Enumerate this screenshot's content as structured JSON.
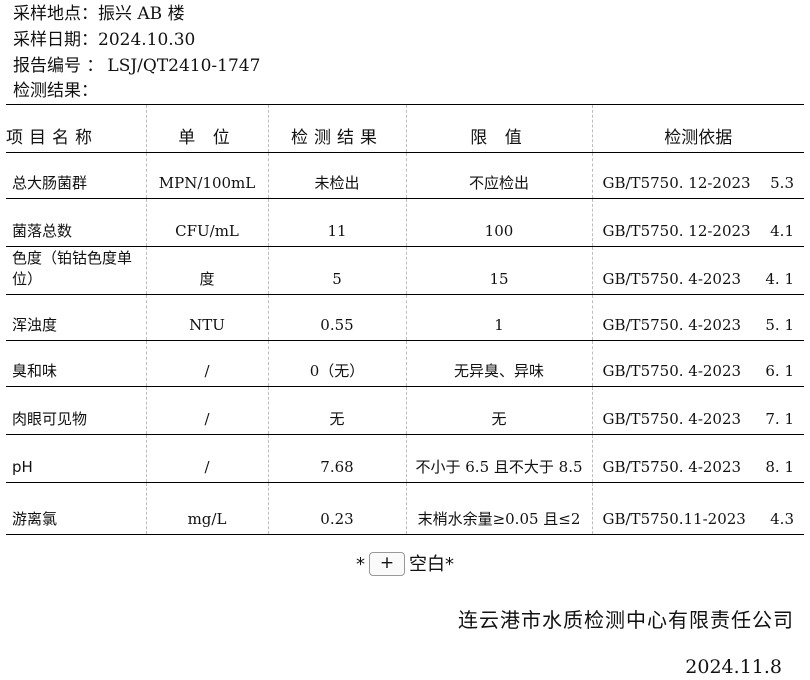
{
  "meta": {
    "location_label": "采样地点：",
    "location": "振兴 AB 楼",
    "date_label": "采样日期：",
    "date": "2024.10.30",
    "report_label": "报告编号 ：",
    "report_no": "LSJ/QT2410-1747",
    "result_label": "检测结果："
  },
  "table": {
    "headers": [
      "项目名称",
      "单 位",
      "检测结果",
      "限 值",
      "检测依据"
    ],
    "rows": [
      {
        "name": "总大肠菌群",
        "unit": "MPN/100mL",
        "result": "未检出",
        "limit": "不应检出",
        "basis": "GB/T5750. 12-2023",
        "clause": "5.3"
      },
      {
        "name": "菌落总数",
        "unit": "CFU/mL",
        "result": "11",
        "limit": "100",
        "basis": "GB/T5750. 12-2023",
        "clause": "4.1"
      },
      {
        "name": "色度（铂钴色度单位）",
        "unit": "度",
        "result": "5",
        "limit": "15",
        "basis": "GB/T5750. 4-2023",
        "clause": "4. 1"
      },
      {
        "name": "浑浊度",
        "unit": "NTU",
        "result": "0.55",
        "limit": "1",
        "basis": "GB/T5750. 4-2023",
        "clause": "5. 1"
      },
      {
        "name": "臭和味",
        "unit": "/",
        "result": "0（无）",
        "limit": "无异臭、异味",
        "basis": "GB/T5750. 4-2023",
        "clause": "6. 1"
      },
      {
        "name": "肉眼可见物",
        "unit": "/",
        "result": "无",
        "limit": "无",
        "basis": "GB/T5750. 4-2023",
        "clause": "7. 1"
      },
      {
        "name": "pH",
        "unit": "/",
        "result": "7.68",
        "limit": "不小于 6.5 且不大于 8.5",
        "basis": "GB/T5750. 4-2023",
        "clause": "8. 1"
      },
      {
        "name": "游离氯",
        "unit": "mg/L",
        "result": "0.23",
        "limit": "末梢水余量≥0.05 且≤2",
        "basis": "GB/T5750.11-2023",
        "clause": "4.3"
      }
    ]
  },
  "blank_prefix": "*",
  "blank_button": "+",
  "blank_suffix": "空白*",
  "company": "连云港市水质检测中心有限责任公司",
  "issue_date": "2024.11.8"
}
